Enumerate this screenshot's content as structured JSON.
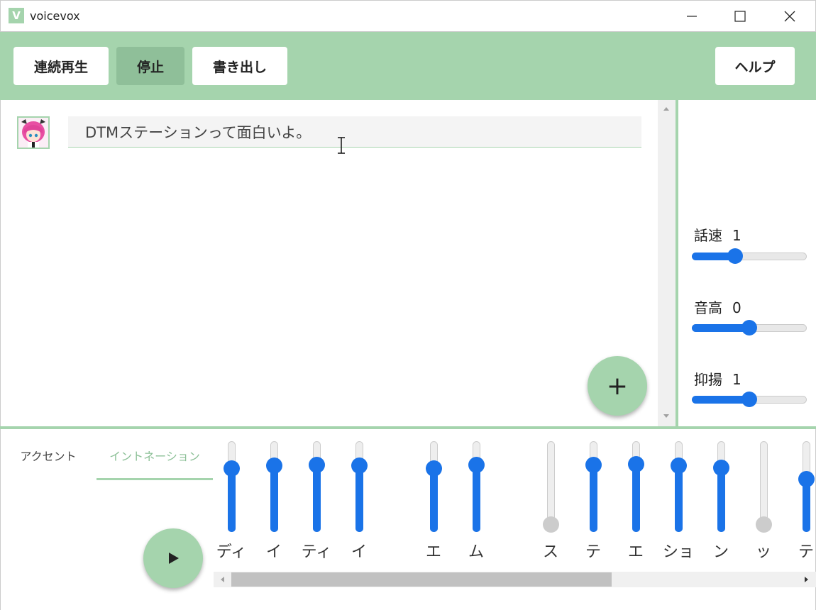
{
  "window": {
    "title": "voicevox",
    "logo_letter": "V"
  },
  "toolbar": {
    "play_all": "連続再生",
    "stop": "停止",
    "export": "書き出し",
    "help": "ヘルプ"
  },
  "main": {
    "text_value": "DTMステーションって面白いよ。",
    "add_label": "+"
  },
  "parameters": [
    {
      "label": "話速",
      "value": "1",
      "slider_fraction": 0.36
    },
    {
      "label": "音高",
      "value": "0",
      "slider_fraction": 0.5
    },
    {
      "label": "抑揚",
      "value": "1",
      "slider_fraction": 0.5
    }
  ],
  "tabs": {
    "accent": "アクセント",
    "intonation": "イントネーション",
    "active": "intonation"
  },
  "moras": [
    {
      "label": "ディ",
      "level": 0.74,
      "active": true
    },
    {
      "label": "イ",
      "level": 0.78,
      "active": true
    },
    {
      "label": "ティ",
      "level": 0.79,
      "active": true
    },
    {
      "label": "イ",
      "level": 0.78,
      "active": true
    },
    {
      "label": "エ",
      "level": 0.74,
      "active": true
    },
    {
      "label": "ム",
      "level": 0.79,
      "active": true
    },
    {
      "label": "ス",
      "level": 0.0,
      "active": false
    },
    {
      "label": "テ",
      "level": 0.79,
      "active": true
    },
    {
      "label": "エ",
      "level": 0.8,
      "active": true
    },
    {
      "label": "ショ",
      "level": 0.78,
      "active": true
    },
    {
      "label": "ン",
      "level": 0.75,
      "active": true
    },
    {
      "label": "ッ",
      "level": 0.0,
      "active": false
    },
    {
      "label": "テ",
      "level": 0.6,
      "active": true
    }
  ],
  "colors": {
    "accent": "#a5d4ad",
    "slider": "#1a73e8",
    "inactive": "#cccccc"
  }
}
